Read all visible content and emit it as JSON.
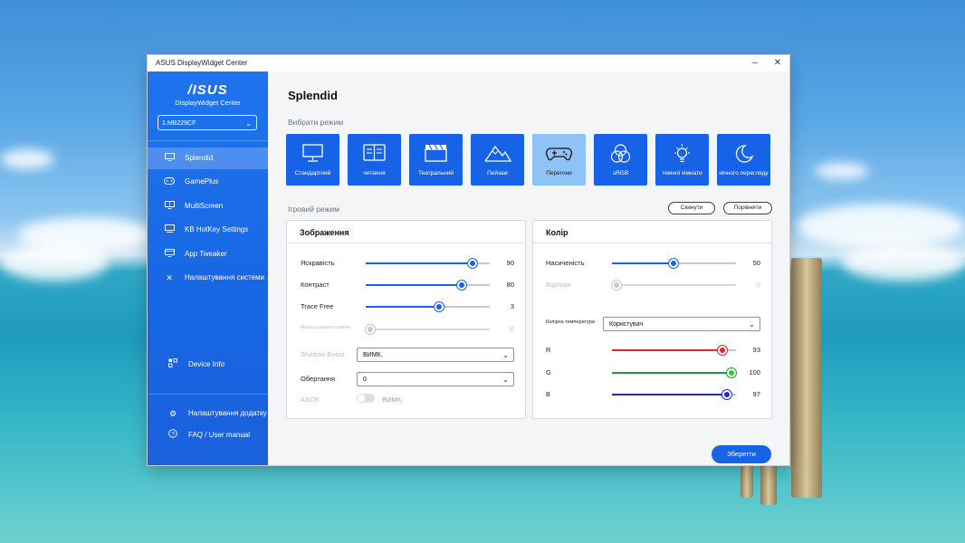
{
  "window": {
    "title": "ASUS DisplayWidget Center",
    "minimize": "–",
    "close": "✕"
  },
  "sidebar": {
    "brand": "/ISUS",
    "app_name": "DisplayWidget Center",
    "monitor": "1.MB229CF",
    "items": [
      {
        "label": "Splendid",
        "icon": "monitor-icon"
      },
      {
        "label": "GamePlus",
        "icon": "gamepad-icon"
      },
      {
        "label": "MultiScreen",
        "icon": "multiscreen-icon"
      },
      {
        "label": "KB HotKey Settings",
        "icon": "keyboard-icon"
      },
      {
        "label": "App Tweaker",
        "icon": "app-icon"
      },
      {
        "label": "Налаштування системи",
        "icon": "tools-icon"
      }
    ],
    "device_info": "Device Info",
    "app_settings": "Налаштування додатку",
    "faq": "FAQ / User manual"
  },
  "main": {
    "title": "Splendid",
    "mode_heading": "Вибрати режим",
    "modes": [
      {
        "label": "Стандартний",
        "icon": "monitor-icon"
      },
      {
        "label": "читання",
        "icon": "book-icon"
      },
      {
        "label": "Театральний",
        "icon": "clapperboard-icon"
      },
      {
        "label": "Пейзаж",
        "icon": "mountain-icon"
      },
      {
        "label": "Перегони",
        "icon": "gamepad-icon"
      },
      {
        "label": "sRGB",
        "icon": "rgb-circles-icon"
      },
      {
        "label": "темної кімнати",
        "icon": "bulb-icon"
      },
      {
        "label": "нічного перегляду",
        "icon": "moon-icon"
      }
    ],
    "selected_mode": "Перегони",
    "current_mode_label": "Ігровий режим",
    "reset": "Скинути",
    "compare": "Порівняти",
    "image_panel": {
      "title": "Зображення",
      "brightness": {
        "label": "Яскравість",
        "value": 90
      },
      "contrast": {
        "label": "Контраст",
        "value": 80
      },
      "trace_free": {
        "label": "Trace Free",
        "value": 3
      },
      "blue_light": {
        "label": "Фільтр синього світла",
        "value": 0
      },
      "shadow_boost": {
        "label": "Shadow Boost",
        "value": "ВИМК."
      },
      "rotation": {
        "label": "Обертання",
        "value": "0"
      },
      "ascr": {
        "label": "ASCR",
        "value": "ВИМК."
      }
    },
    "color_panel": {
      "title": "Колір",
      "saturation": {
        "label": "Насиченість",
        "value": 50
      },
      "hue": {
        "label": "Відтінок",
        "value": 0
      },
      "color_temp": {
        "label": "Колірна температура",
        "value": "Користувач"
      },
      "r": {
        "label": "R",
        "value": 93
      },
      "g": {
        "label": "G",
        "value": 100
      },
      "b": {
        "label": "B",
        "value": 97
      }
    },
    "save": "Зберегти"
  },
  "colors": {
    "sidebar": "#1766e3",
    "accent": "#1765e6",
    "red": "#d9262b",
    "green": "#1aa32a",
    "blue": "#1d2fbf"
  }
}
